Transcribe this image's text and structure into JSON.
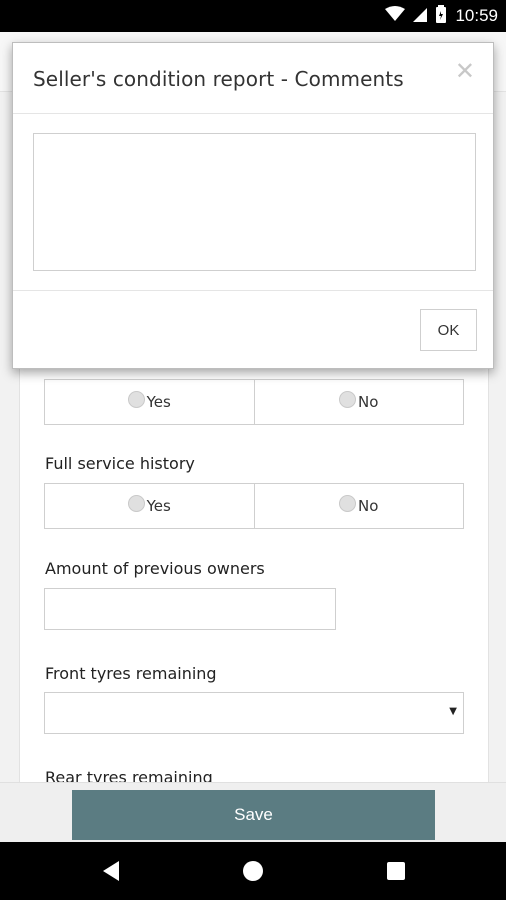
{
  "status_bar": {
    "time": "10:59",
    "icons": [
      "wifi-icon",
      "signal-icon",
      "battery-icon"
    ]
  },
  "modal": {
    "title": "Seller's condition report - Comments",
    "close_icon": "close-icon",
    "textarea_value": "",
    "ok_label": "OK"
  },
  "form": {
    "row1": {
      "yes": "Yes",
      "no": "No"
    },
    "full_service_history": {
      "label": "Full service history",
      "yes": "Yes",
      "no": "No"
    },
    "previous_owners": {
      "label": "Amount of previous owners",
      "value": ""
    },
    "front_tyres": {
      "label": "Front tyres remaining",
      "value": ""
    },
    "rear_tyres": {
      "label": "Rear tyres remaining"
    }
  },
  "save_bar": {
    "save_label": "Save"
  },
  "nav_bar": {
    "icons": [
      "back-icon",
      "home-icon",
      "recents-icon"
    ]
  },
  "colors": {
    "accent": "#5b7c82",
    "status_bar": "#000000"
  }
}
